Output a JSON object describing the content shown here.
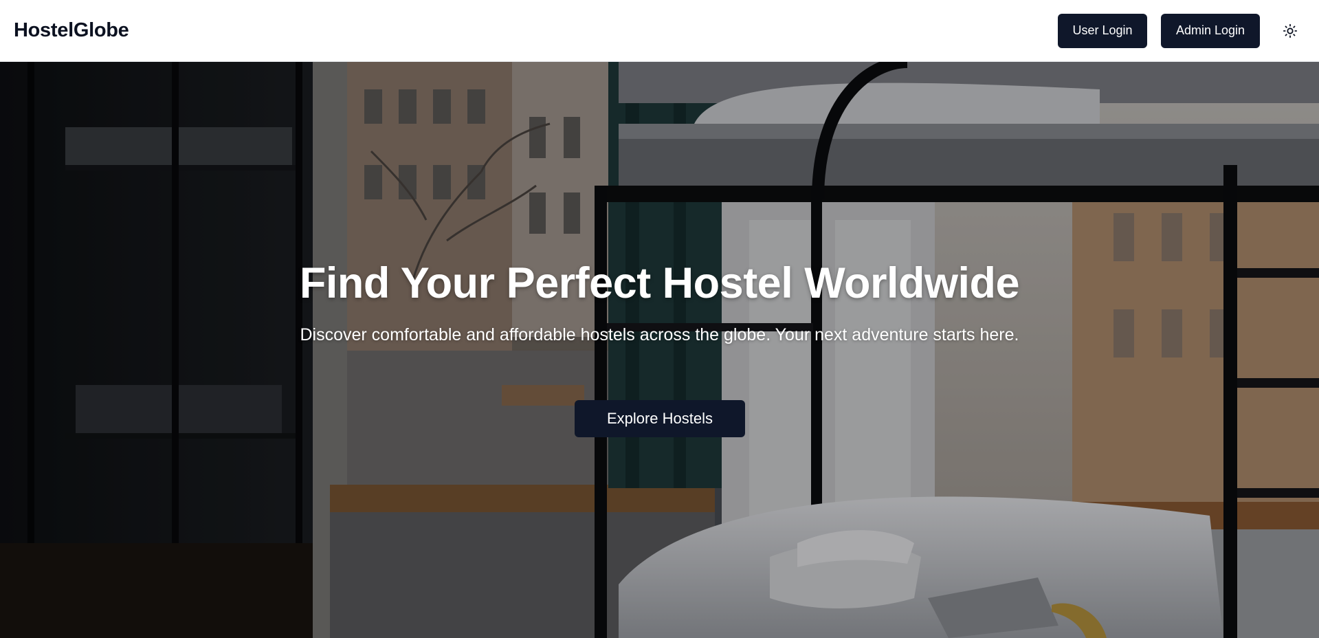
{
  "header": {
    "brand": "HostelGlobe",
    "user_login_label": "User Login",
    "admin_login_label": "Admin Login",
    "theme_toggle_icon": "sun-icon"
  },
  "hero": {
    "title": "Find Your Perfect Hostel Worldwide",
    "subtitle": "Discover comfortable and affordable hostels across the globe. Your next adventure starts here.",
    "cta_label": "Explore Hostels",
    "background_image": "hostel-dorm-bunk-beds-photo"
  },
  "colors": {
    "accent": "#0f172a",
    "brand_text": "#0b1120",
    "hero_text": "#ffffff"
  }
}
